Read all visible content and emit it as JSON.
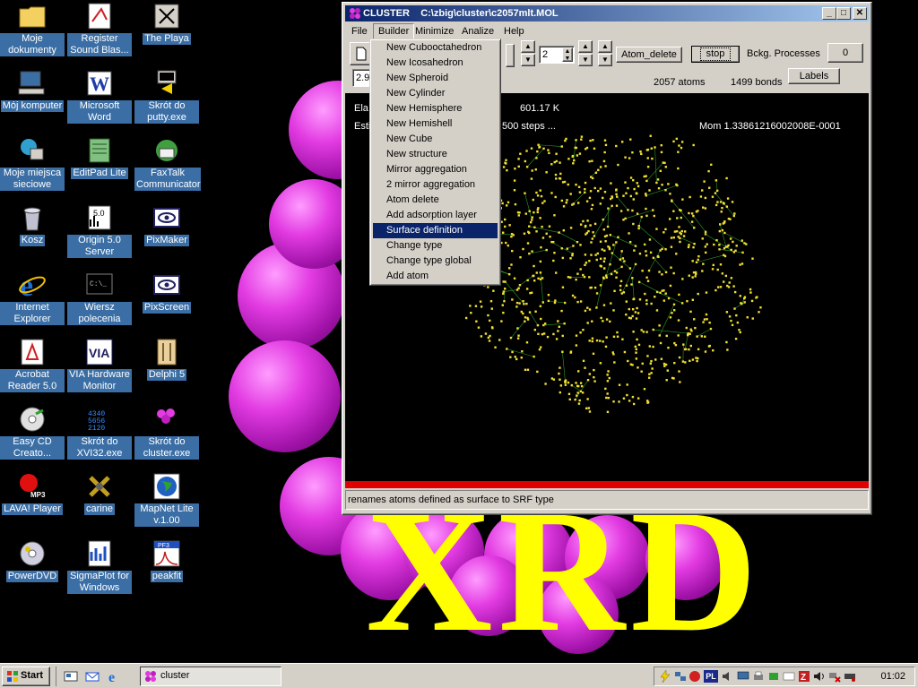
{
  "desktop": {
    "icons": [
      {
        "label": "Moje dokumenty",
        "icon": "folder-icon"
      },
      {
        "label": "Register Sound Blas...",
        "icon": "register-icon"
      },
      {
        "label": "The Playa",
        "icon": "app-icon"
      },
      {
        "label": "Mój komputer",
        "icon": "computer-icon"
      },
      {
        "label": "Microsoft Word",
        "icon": "word-icon"
      },
      {
        "label": "Skrót do putty.exe",
        "icon": "putty-icon"
      },
      {
        "label": "Moje miejsca sieciowe",
        "icon": "network-icon"
      },
      {
        "label": "EditPad Lite",
        "icon": "editpad-icon"
      },
      {
        "label": "FaxTalk Communicator",
        "icon": "faxtalk-icon"
      },
      {
        "label": "Kosz",
        "icon": "recycle-bin-icon"
      },
      {
        "label": "Origin 5.0 Server",
        "icon": "origin-icon"
      },
      {
        "label": "PixMaker",
        "icon": "pixmaker-icon"
      },
      {
        "label": "Internet Explorer",
        "icon": "ie-icon"
      },
      {
        "label": "Wiersz polecenia",
        "icon": "cmd-icon"
      },
      {
        "label": "PixScreen",
        "icon": "pixscreen-icon"
      },
      {
        "label": "Acrobat Reader 5.0",
        "icon": "acrobat-icon"
      },
      {
        "label": "VIA Hardware Monitor",
        "icon": "via-icon"
      },
      {
        "label": "Delphi 5",
        "icon": "delphi-icon"
      },
      {
        "label": "Easy CD Creato...",
        "icon": "cd-icon"
      },
      {
        "label": "Skrót do XVI32.exe",
        "icon": "hex-icon"
      },
      {
        "label": "Skrót do cluster.exe",
        "icon": "cluster-icon"
      },
      {
        "label": "LAVA! Player",
        "icon": "mp3-icon"
      },
      {
        "label": "carine",
        "icon": "carine-icon"
      },
      {
        "label": "MapNet Lite v.1.00",
        "icon": "globe-icon"
      },
      {
        "label": "PowerDVD",
        "icon": "dvd-icon"
      },
      {
        "label": "SigmaPlot for Windows",
        "icon": "sigmaplot-icon"
      },
      {
        "label": "peakfit",
        "icon": "peakfit-icon"
      }
    ],
    "wallpaper_text": "XRD"
  },
  "window": {
    "title": "CLUSTER",
    "path": "C:\\zbig\\cluster\\c2057mlt.MOL",
    "menu": [
      "File",
      "Builder",
      "Minimize",
      "Analize",
      "Help"
    ],
    "toolbar": {
      "spin_value": "2",
      "field_value": "2.9",
      "atom_delete": "Atom_delete",
      "stop": "stop",
      "bckg_label": "Bckg. Processes",
      "bckg_value": "0",
      "labels_button": "Labels",
      "atoms": "2057 atoms",
      "bonds": "1499 bonds"
    },
    "canvas": {
      "elapsed_prefix": "Ela",
      "elapsed_value": "601.17 K",
      "est_prefix": "Esti",
      "steps_text": "500 steps ...",
      "mom_text": "Mom 1.33861216002008E-0001"
    },
    "status": "renames atoms defined as surface to SRF type"
  },
  "builder_menu": {
    "items": [
      "New Cubooctahedron",
      "New Icosahedron",
      "New Spheroid",
      "New Cylinder",
      "New Hemisphere",
      "New Hemishell",
      "New Cube",
      "New structure",
      "Mirror aggregation",
      "2 mirror aggregation",
      "Atom delete",
      "Add adsorption layer",
      "Surface definition",
      "Change type",
      "Change type global",
      "Add atom"
    ],
    "selected": "Surface definition"
  },
  "taskbar": {
    "start": "Start",
    "task": "cluster",
    "clock": "01:02",
    "tray_language": "PL"
  },
  "colors": {
    "desktop_label_bg": "#3a6ea5",
    "title_active": "#0a246a",
    "ball": "#e23be2",
    "xrd": "#ffff00",
    "bond": "#2a9a2a",
    "atom": "#f0e030",
    "progress": "#e00000"
  }
}
